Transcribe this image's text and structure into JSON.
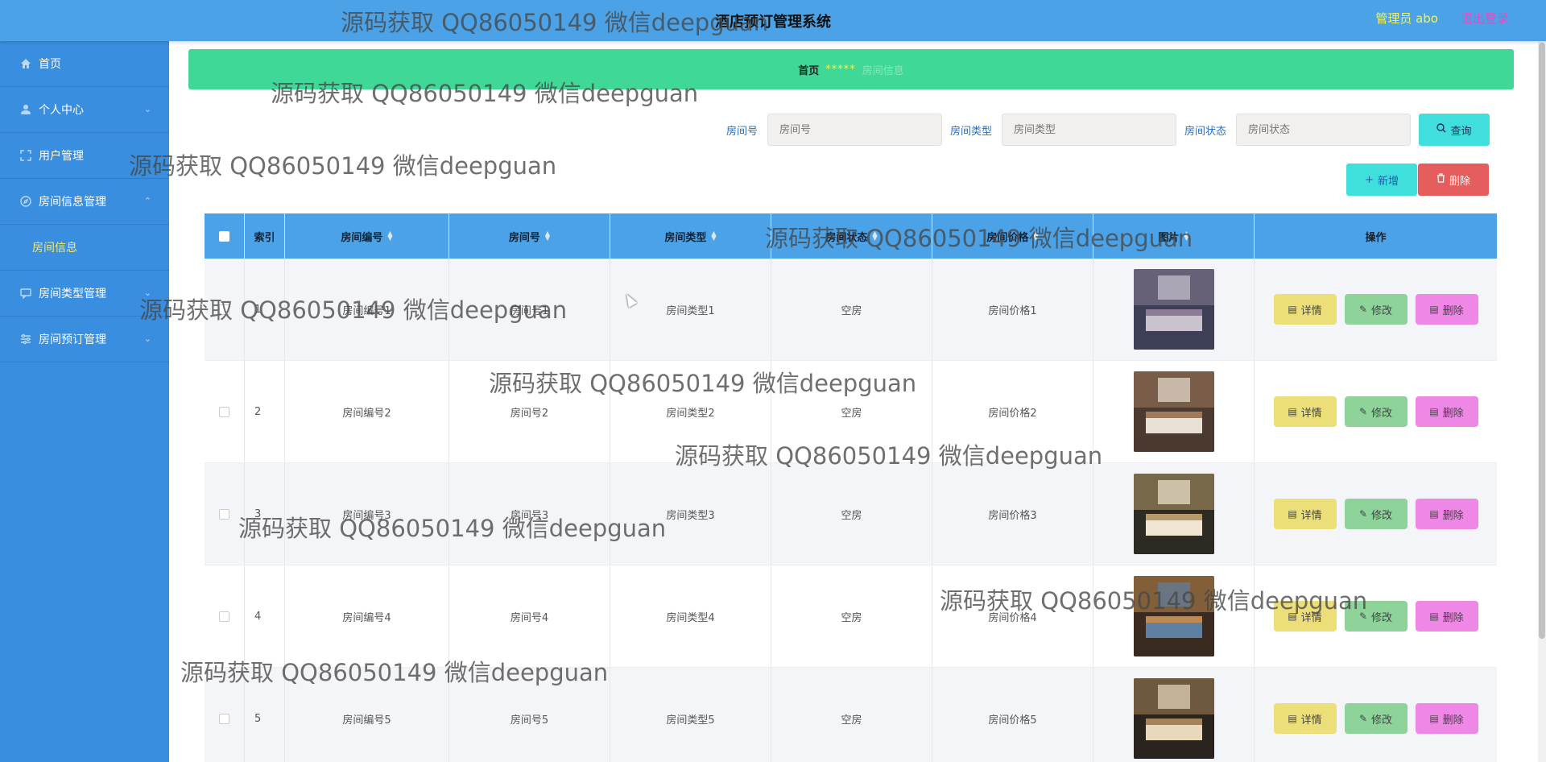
{
  "app": {
    "title": "酒店预订管理系统",
    "admin_label": "管理员 abo",
    "logout_label": "退出登录"
  },
  "sidebar": {
    "items": [
      {
        "label": "首页",
        "icon": "home-icon"
      },
      {
        "label": "个人中心",
        "icon": "user-icon"
      },
      {
        "label": "用户管理",
        "icon": "fullscreen-icon"
      },
      {
        "label": "房间信息管理",
        "icon": "compass-icon"
      },
      {
        "label": "房间类型管理",
        "icon": "chat-icon"
      },
      {
        "label": "房间预订管理",
        "icon": "sliders-icon"
      }
    ],
    "sub_item": "房间信息"
  },
  "breadcrumb": {
    "home": "首页",
    "separator": "*****",
    "current": "房间信息"
  },
  "search": {
    "room_no_label": "房间号",
    "room_no_placeholder": "房间号",
    "room_type_label": "房间类型",
    "room_type_placeholder": "房间类型",
    "room_status_label": "房间状态",
    "room_status_placeholder": "房间状态",
    "query_label": "查询"
  },
  "actions": {
    "add_label": "新增",
    "delete_label": "删除"
  },
  "table": {
    "headers": [
      "索引",
      "房间编号",
      "房间号",
      "房间类型",
      "房间状态",
      "房间价格",
      "图片",
      "操作"
    ],
    "rows": [
      {
        "index": "1",
        "code": "房间编号1",
        "room_no": "房间号1",
        "type": "房间类型1",
        "status": "空房",
        "price": "房间价格1"
      },
      {
        "index": "2",
        "code": "房间编号2",
        "room_no": "房间号2",
        "type": "房间类型2",
        "status": "空房",
        "price": "房间价格2"
      },
      {
        "index": "3",
        "code": "房间编号3",
        "room_no": "房间号3",
        "type": "房间类型3",
        "status": "空房",
        "price": "房间价格3"
      },
      {
        "index": "4",
        "code": "房间编号4",
        "room_no": "房间号4",
        "type": "房间类型4",
        "status": "空房",
        "price": "房间价格4"
      },
      {
        "index": "5",
        "code": "房间编号5",
        "room_no": "房间号5",
        "type": "房间类型5",
        "status": "空房",
        "price": "房间价格5"
      }
    ],
    "op_detail": "详情",
    "op_edit": "修改",
    "op_delete": "删除"
  },
  "watermark": "源码获取 QQ86050149 微信deepguan",
  "colors": {
    "topbar": "#4ca2e6",
    "sidebar": "#3a8ee0",
    "breadcrumb": "#3fd897",
    "detail": "#ecdf79",
    "edit": "#8ed39a",
    "delete": "#ef87e6"
  }
}
